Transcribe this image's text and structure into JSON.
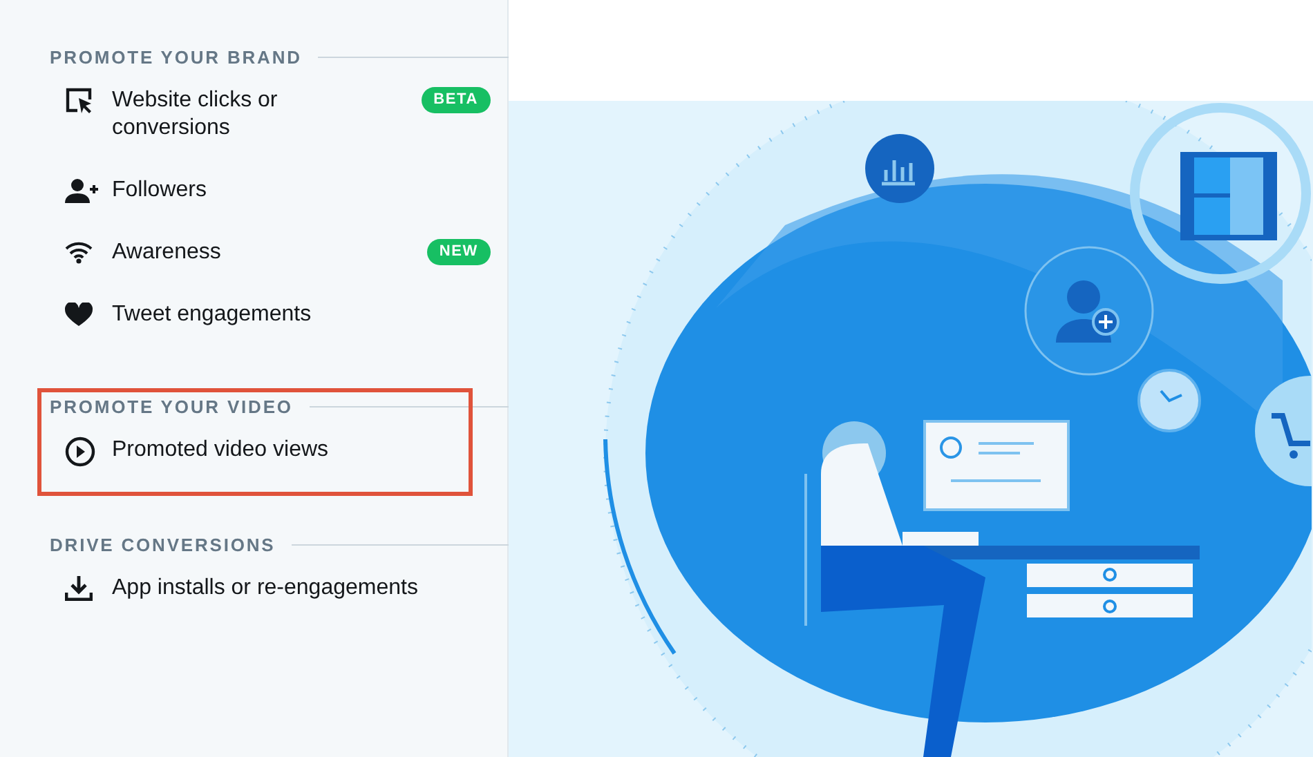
{
  "sections": [
    {
      "title": "PROMOTE YOUR BRAND",
      "highlighted": false,
      "items": [
        {
          "label": "Website clicks or conversions",
          "kind": "cursor",
          "badge": {
            "text": "BETA",
            "color": "#17bf63"
          }
        },
        {
          "label": "Followers",
          "kind": "person-add"
        },
        {
          "label": "Awareness",
          "kind": "wifi",
          "badge": {
            "text": "NEW",
            "color": "#17bf63"
          }
        },
        {
          "label": "Tweet engagements",
          "kind": "heart"
        }
      ]
    },
    {
      "title": "PROMOTE YOUR VIDEO",
      "highlighted": true,
      "items": [
        {
          "label": "Promoted video views",
          "kind": "play"
        }
      ]
    },
    {
      "title": "DRIVE CONVERSIONS",
      "highlighted": false,
      "items": [
        {
          "label": "App installs or re-engagements",
          "kind": "download"
        }
      ]
    }
  ]
}
